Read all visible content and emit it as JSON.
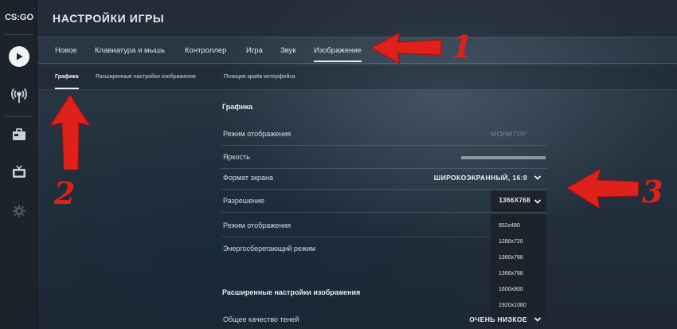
{
  "app": {
    "logo_text": "CS:GO"
  },
  "header": {
    "title": "НАСТРОЙКИ ИГРЫ"
  },
  "sidebar": {
    "items": [
      {
        "name": "play",
        "icon": "play-icon"
      },
      {
        "name": "broadcast",
        "icon": "broadcast-icon"
      },
      {
        "name": "inventory",
        "icon": "briefcase-icon"
      },
      {
        "name": "watch",
        "icon": "tv-icon"
      },
      {
        "name": "settings",
        "icon": "gear-icon"
      }
    ]
  },
  "tabs": [
    {
      "label": "Новое"
    },
    {
      "label": "Клавиатура и мышь"
    },
    {
      "label": "Контроллер"
    },
    {
      "label": "Игра"
    },
    {
      "label": "Звук"
    },
    {
      "label": "Изображение",
      "active": true
    }
  ],
  "subtabs": [
    {
      "label": "Графика",
      "active": true
    },
    {
      "label": "Расширенные настройки изображения"
    },
    {
      "label": "Позиция краёв интерфейса"
    }
  ],
  "settings": {
    "section_title": "Графика",
    "rows": [
      {
        "label": "Режим отображения",
        "value": "МОНИТОР",
        "disabled": true
      },
      {
        "label": "Яркость"
      },
      {
        "label": "Формат экрана",
        "value": "ШИРОКОЭКРАННЫЙ, 16:9"
      },
      {
        "label": "Разрешение",
        "value": "1366X768"
      },
      {
        "label": "Режим отображения"
      },
      {
        "label": "Энергосберегающий режим"
      }
    ],
    "resolution_options": [
      "852x480",
      "1280x720",
      "1360x768",
      "1366x768",
      "1600x900",
      "1920x1080"
    ],
    "advanced_title": "Расширенные настройки изображения",
    "advanced_rows": [
      {
        "label": "Общее качество теней",
        "value": "ОЧЕНЬ НИЗКОЕ"
      }
    ]
  },
  "annotations": {
    "one": "1",
    "two": "2",
    "three": "3"
  },
  "colors": {
    "accent_arrow": "#e0201b",
    "sidebar_bg": "#1c232b",
    "active_underline": "#e9eef2"
  }
}
